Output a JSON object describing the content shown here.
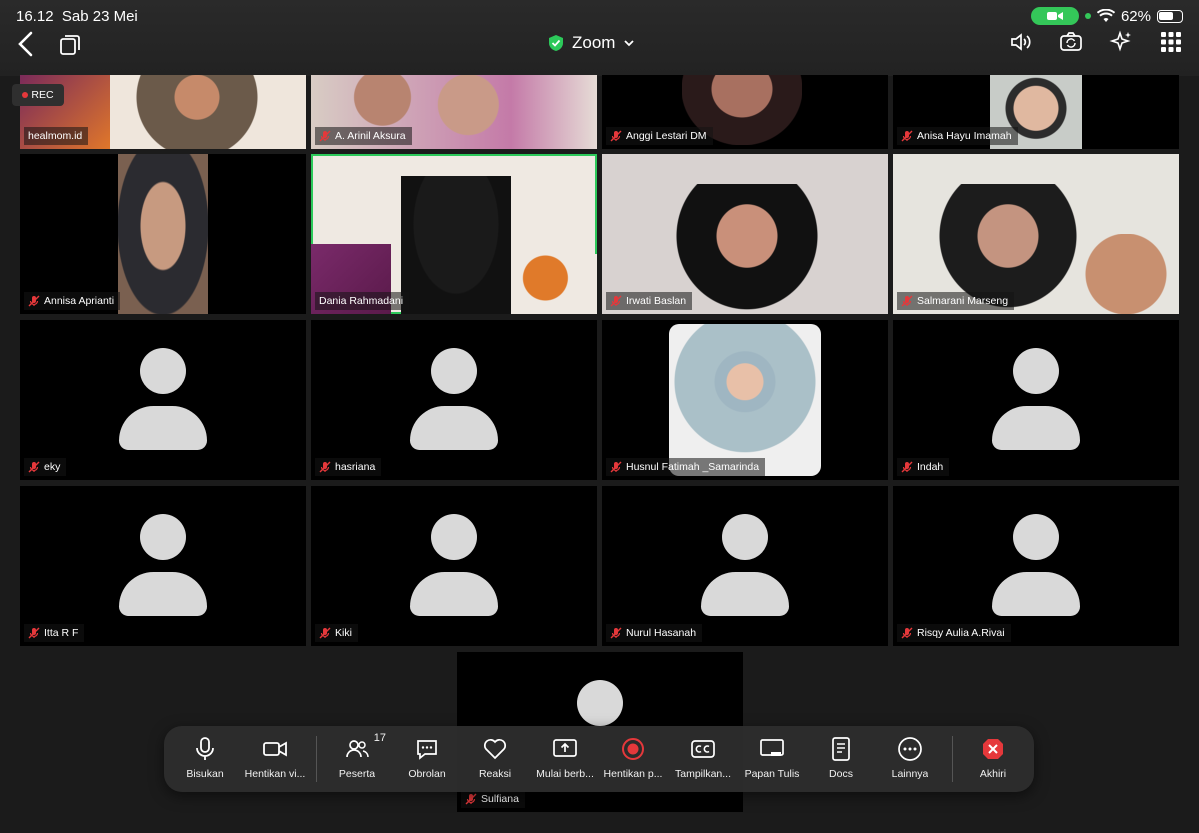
{
  "status": {
    "time": "16.12",
    "date": "Sab 23 Mei",
    "battery": "62%"
  },
  "header": {
    "title": "Zoom"
  },
  "recording": {
    "label": "REC"
  },
  "participants": [
    {
      "name": "healmom.id"
    },
    {
      "name": "A. Arinil Aksura"
    },
    {
      "name": "Anggi Lestari DM"
    },
    {
      "name": "Anisa Hayu Imamah"
    },
    {
      "name": "Annisa Aprianti"
    },
    {
      "name": "Dania Rahmadani"
    },
    {
      "name": "Irwati Baslan"
    },
    {
      "name": "Salmarani Marseng"
    },
    {
      "name": "eky"
    },
    {
      "name": "hasriana"
    },
    {
      "name": "Husnul Fatimah _Samarinda"
    },
    {
      "name": "Indah"
    },
    {
      "name": "Itta R F"
    },
    {
      "name": "Kiki"
    },
    {
      "name": "Nurul Hasanah"
    },
    {
      "name": "Risqy Aulia A.Rivai"
    },
    {
      "name": "Sulfiana"
    }
  ],
  "toolbar": {
    "mute": "Bisukan",
    "stop_video": "Hentikan vi...",
    "participants": "Peserta",
    "participants_count": "17",
    "chat": "Obrolan",
    "react": "Reaksi",
    "share": "Mulai berb...",
    "stop_recording": "Hentikan p...",
    "captions": "Tampilkan...",
    "whiteboard": "Papan Tulis",
    "docs": "Docs",
    "more": "Lainnya",
    "end": "Akhiri"
  },
  "colors": {
    "active_speaker": "#2cc95a",
    "end_button": "#e5383b",
    "battery_pill": "#34c759"
  }
}
